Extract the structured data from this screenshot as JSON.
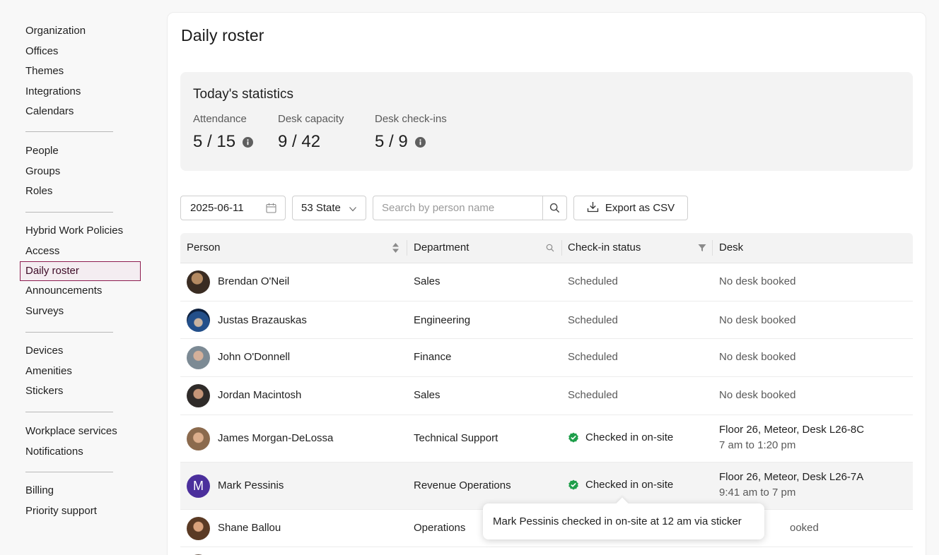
{
  "sidebar": {
    "groups": [
      [
        "Organization",
        "Offices",
        "Themes",
        "Integrations",
        "Calendars"
      ],
      [
        "People",
        "Groups",
        "Roles"
      ],
      [
        "Hybrid Work Policies",
        "Access",
        "Daily roster",
        "Announcements",
        "Surveys"
      ],
      [
        "Devices",
        "Amenities",
        "Stickers"
      ],
      [
        "Workplace services",
        "Notifications"
      ],
      [
        "Billing",
        "Priority support"
      ]
    ],
    "active": "Daily roster"
  },
  "page": {
    "title": "Daily roster"
  },
  "stats": {
    "title": "Today's statistics",
    "attendance": {
      "label": "Attendance",
      "value": "5 / 15"
    },
    "capacity": {
      "label": "Desk capacity",
      "value": "9 / 42"
    },
    "checkins": {
      "label": "Desk check-ins",
      "value": "5 / 9"
    }
  },
  "toolbar": {
    "date": "2025-06-11",
    "office": "53 State",
    "search_placeholder": "Search by person name",
    "export_label": "Export as CSV"
  },
  "table": {
    "headers": {
      "person": "Person",
      "department": "Department",
      "status": "Check-in status",
      "desk": "Desk"
    },
    "rows": [
      {
        "name": "Brendan O'Neil",
        "department": "Sales",
        "status": "Scheduled",
        "desk": "No desk booked",
        "desk_time": ""
      },
      {
        "name": "Justas Brazauskas",
        "department": "Engineering",
        "status": "Scheduled",
        "desk": "No desk booked",
        "desk_time": ""
      },
      {
        "name": "John O'Donnell",
        "department": "Finance",
        "status": "Scheduled",
        "desk": "No desk booked",
        "desk_time": ""
      },
      {
        "name": "Jordan Macintosh",
        "department": "Sales",
        "status": "Scheduled",
        "desk": "No desk booked",
        "desk_time": ""
      },
      {
        "name": "James Morgan-DeLossa",
        "department": "Technical Support",
        "status": "Checked in on-site",
        "desk": "Floor 26, Meteor, Desk L26-8C",
        "desk_time": "7 am to 1:20 pm"
      },
      {
        "name": "Mark Pessinis",
        "initial": "M",
        "department": "Revenue Operations",
        "status": "Checked in on-site",
        "desk": "Floor 26, Meteor, Desk L26-7A",
        "desk_time": "9:41 am to 7 pm"
      },
      {
        "name": "Shane Ballou",
        "department": "Operations",
        "status": "",
        "desk": "ooked",
        "desk_time": ""
      }
    ]
  },
  "tooltip": {
    "text": "Mark Pessinis checked in on-site at 12 am via sticker"
  },
  "colors": {
    "accent": "#8d1c4f",
    "success": "#1e9e4a",
    "avatar_purple": "#4b2f9c"
  }
}
